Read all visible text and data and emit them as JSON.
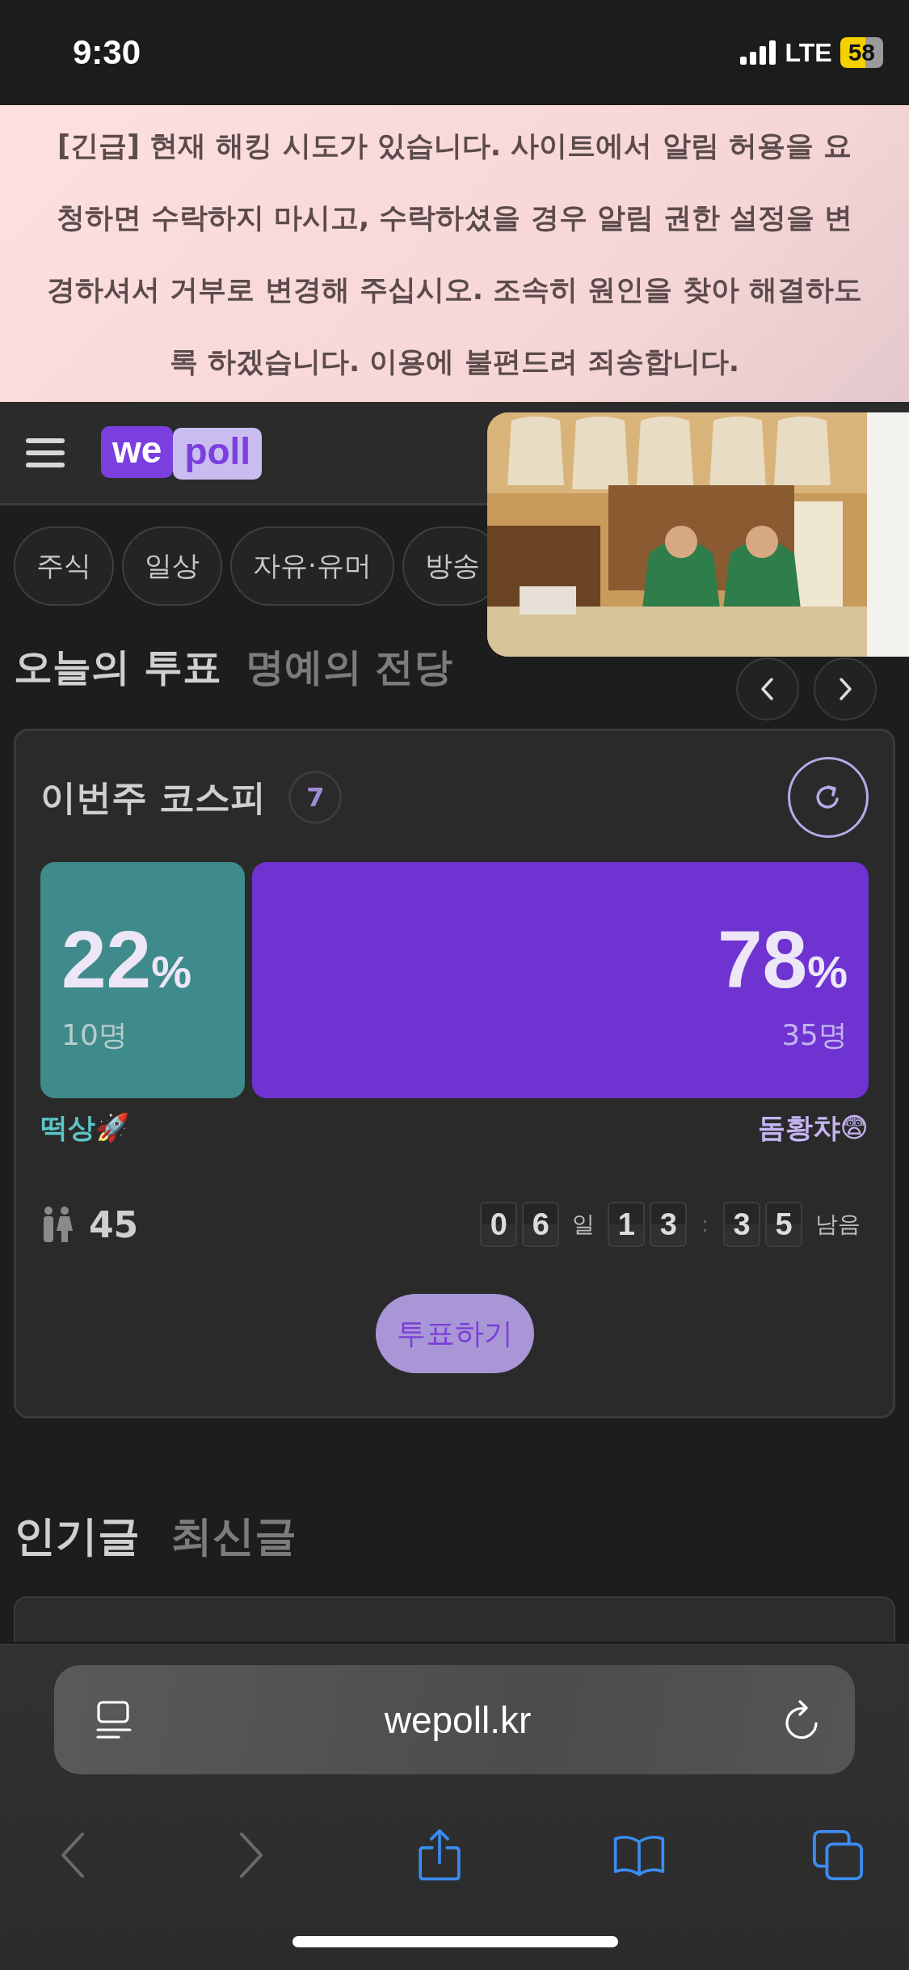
{
  "status_bar": {
    "time": "9:30",
    "network": "LTE",
    "battery": "58"
  },
  "notice": {
    "text": "[긴급] 현재 해킹 시도가 있습니다. 사이트에서 알림 허용을 요청하면 수락하지 마시고, 수락하셨을 경우 알림 권한 설정을 변경하셔서 거부로 변경해 주십시오. 조속히 원인을 찾아 해결하도록 하겠습니다. 이용에 불편드려 죄송합니다."
  },
  "header": {
    "logo": [
      "we",
      "poll"
    ]
  },
  "categories": [
    "주식",
    "일상",
    "자유·유머",
    "방송"
  ],
  "poll_tabs": [
    {
      "label": "오늘의 투표",
      "selected": true
    },
    {
      "label": "명예의 전당",
      "selected": false
    }
  ],
  "poll": {
    "title": "이번주 코스피",
    "badge": "7",
    "options": [
      {
        "name": "떡상🚀",
        "percent": "22",
        "unit": "%",
        "count": "10명",
        "color": "#3f8a8a"
      },
      {
        "name": "돔황챠😨",
        "percent": "78",
        "unit": "%",
        "count": "35명",
        "color": "#6e33d0"
      }
    ],
    "participants": "45",
    "countdown": [
      {
        "kind": "digit",
        "text": "0"
      },
      {
        "kind": "digit",
        "text": "6"
      },
      {
        "kind": "label",
        "text": "일"
      },
      {
        "kind": "digit",
        "text": "1"
      },
      {
        "kind": "digit",
        "text": "3"
      },
      {
        "kind": "sep",
        "text": ":"
      },
      {
        "kind": "digit",
        "text": "3"
      },
      {
        "kind": "digit",
        "text": "5"
      },
      {
        "kind": "label",
        "text": "남음"
      }
    ],
    "vote_button": "투표하기"
  },
  "post_tabs": [
    {
      "label": "인기글",
      "selected": true
    },
    {
      "label": "최신글",
      "selected": false
    }
  ],
  "browser": {
    "url": "wepoll.kr"
  }
}
